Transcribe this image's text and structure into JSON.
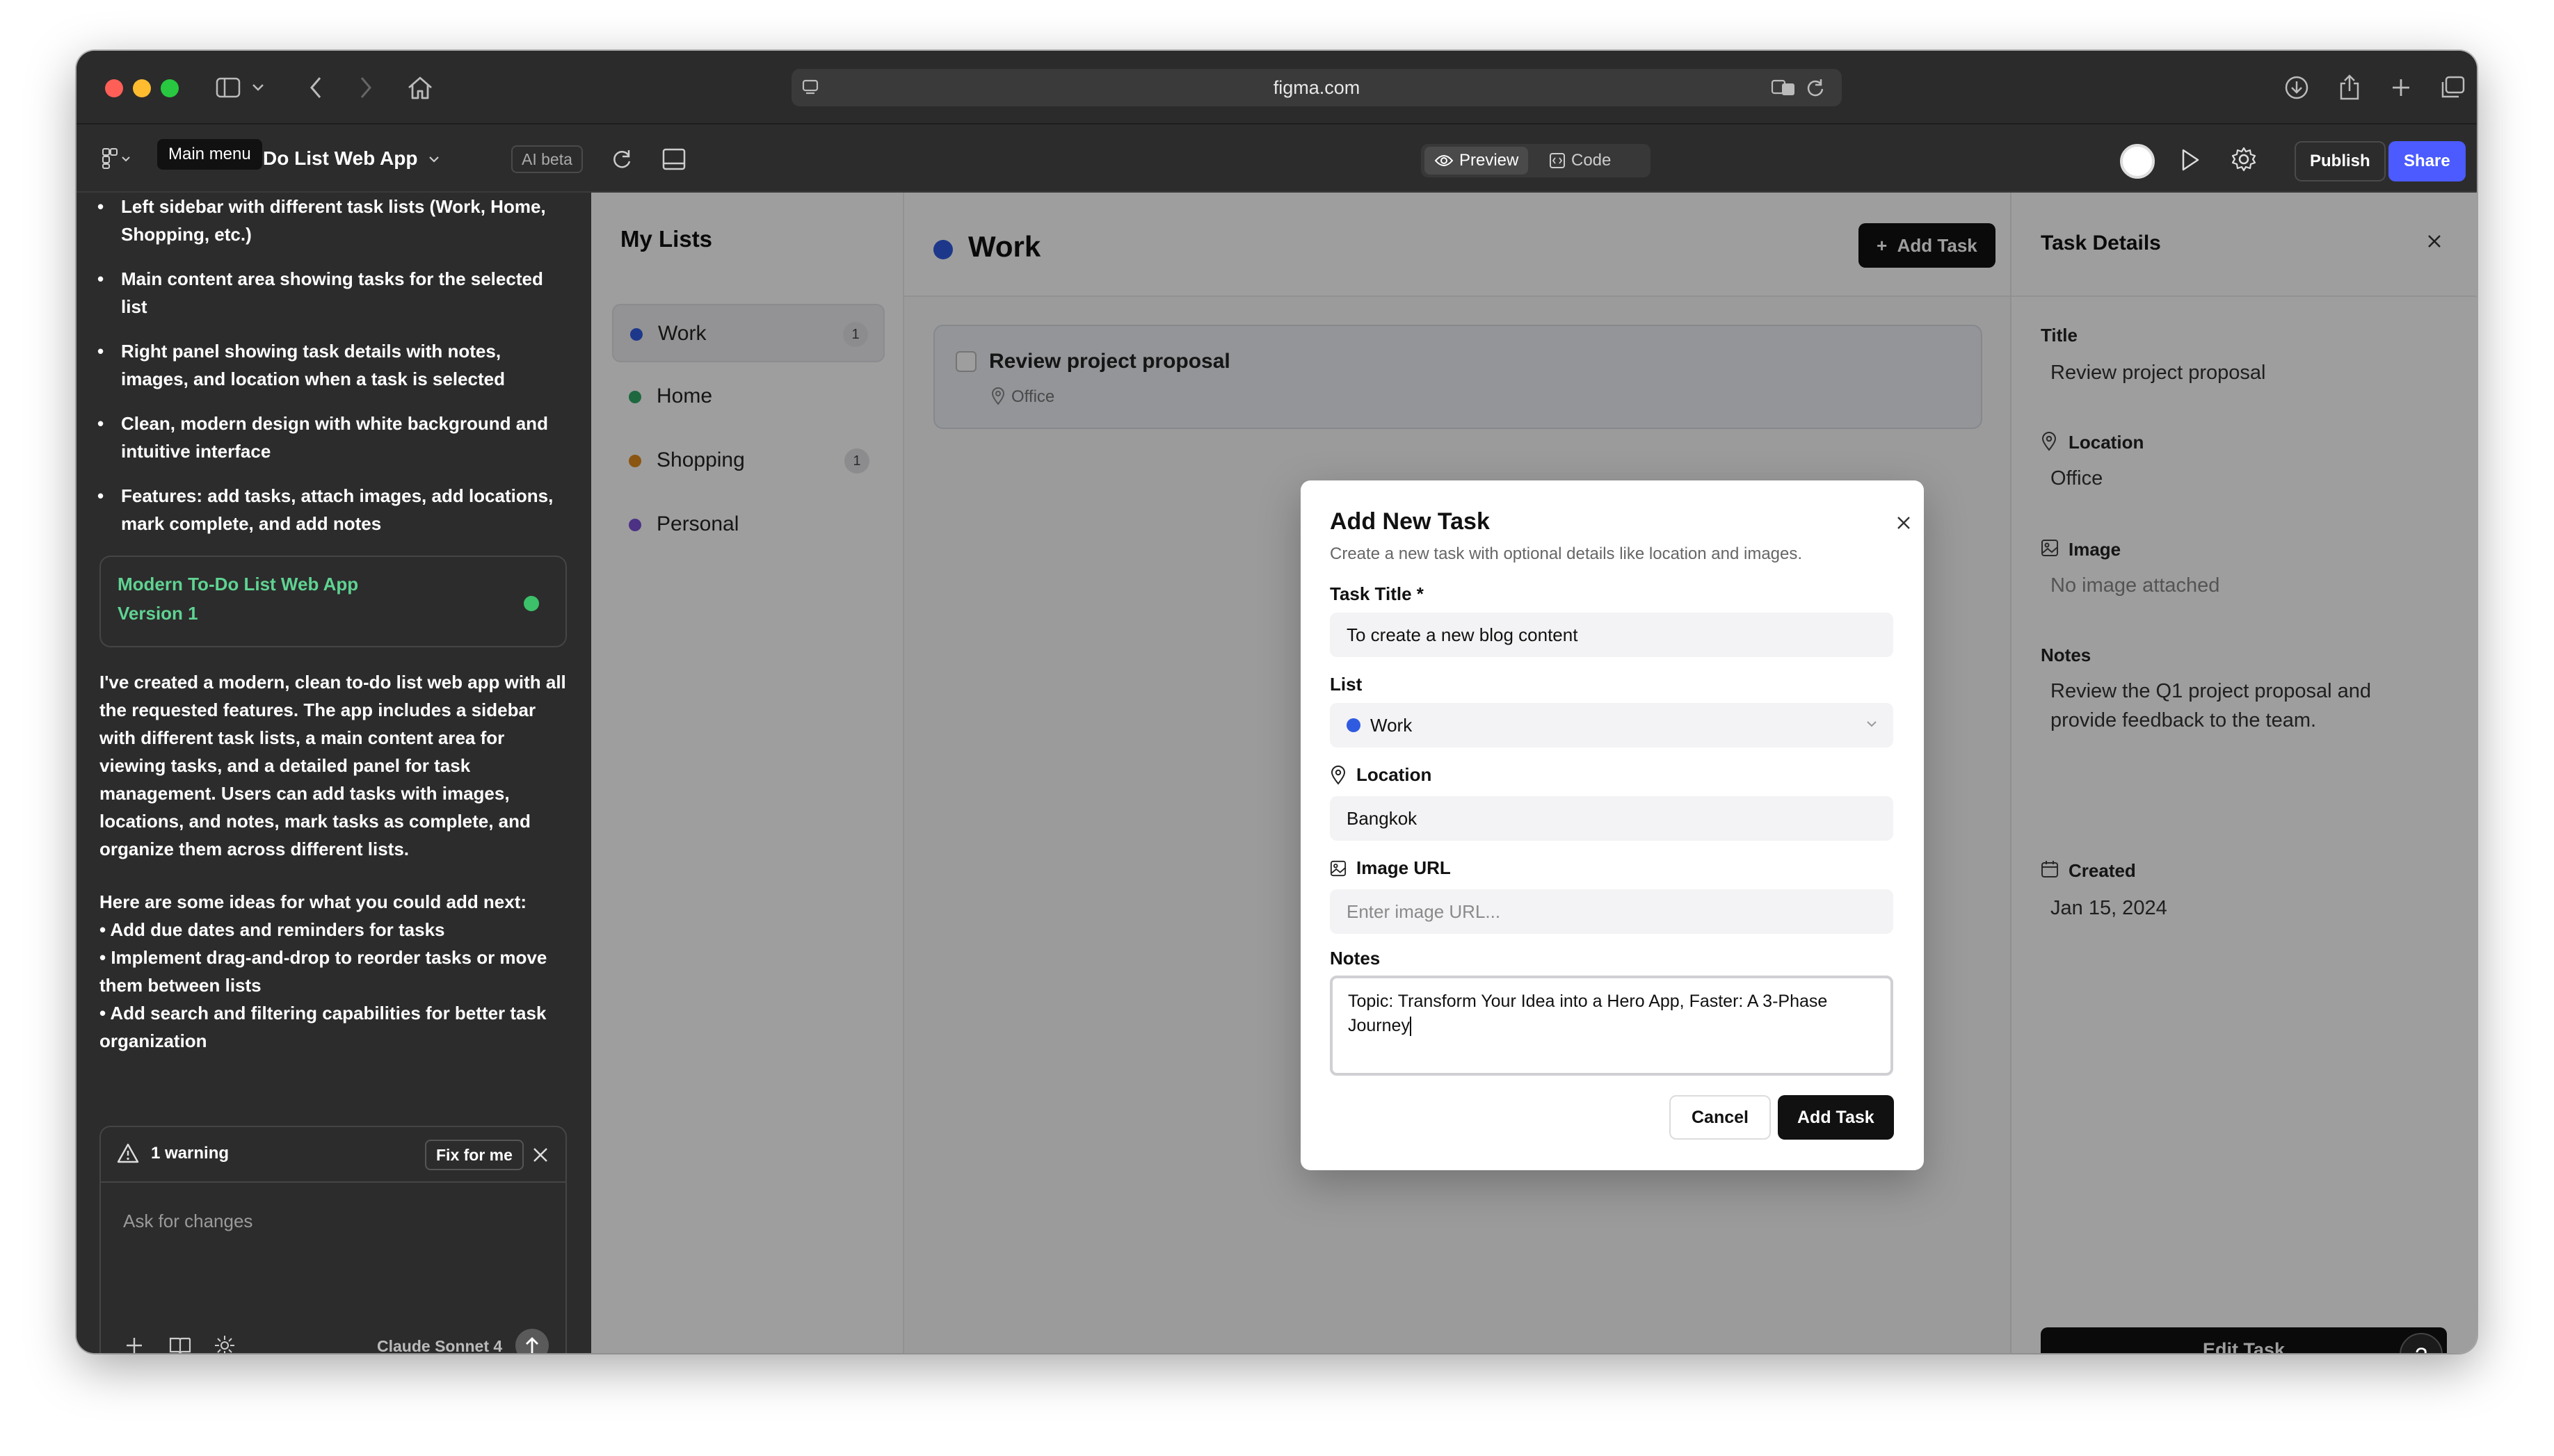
{
  "browser": {
    "url": "figma.com"
  },
  "figma": {
    "tooltip": "Main menu",
    "project_name": "Do List Web App",
    "ai_badge": "AI beta",
    "preview_label": "Preview",
    "code_label": "Code",
    "publish_label": "Publish",
    "share_label": "Share"
  },
  "chat": {
    "bullets": [
      "Left sidebar with different task lists (Work, Home, Shopping, etc.)",
      "Main content area showing tasks for the selected list",
      "Right panel showing task details with notes, images, and location when a task is selected",
      "Clean, modern design with white background and intuitive interface",
      "Features: add tasks, attach images, add locations, mark complete, and add notes"
    ],
    "version_card": {
      "title": "Modern To-Do List Web App",
      "version": "Version 1"
    },
    "summary": "I've created a modern, clean to-do list web app with all the requested features. The app includes a sidebar with different task lists, a main content area for viewing tasks, and a detailed panel for task management. Users can add tasks with images, locations, and notes, mark tasks as complete, and organize them across different lists.",
    "ideas_intro": "Here are some ideas for what you could add next:",
    "ideas": [
      "• Add due dates and reminders for tasks",
      "• Implement drag-and-drop to reorder tasks or move them between lists",
      "• Add search and filtering capabilities for better task organization"
    ],
    "warning_text": "1 warning",
    "fix_label": "Fix for me",
    "input_placeholder": "Ask for changes",
    "model_label": "Claude Sonnet 4"
  },
  "app": {
    "lists_title": "My Lists",
    "lists": [
      {
        "label": "Work",
        "count": "1",
        "color": "#2f5be0"
      },
      {
        "label": "Home",
        "count": "",
        "color": "#2fa866"
      },
      {
        "label": "Shopping",
        "count": "1",
        "color": "#e08a1e"
      },
      {
        "label": "Personal",
        "count": "",
        "color": "#7b4fd6"
      }
    ],
    "main_title": "Work",
    "add_task_label": "Add Task",
    "task": {
      "title": "Review project proposal",
      "location": "Office"
    },
    "details": {
      "header": "Task Details",
      "title_label": "Title",
      "title_value": "Review project proposal",
      "location_label": "Location",
      "location_value": "Office",
      "image_label": "Image",
      "image_value": "No image attached",
      "notes_label": "Notes",
      "notes_value": "Review the Q1 project proposal and provide feedback to the team.",
      "created_label": "Created",
      "created_value": "Jan 15, 2024",
      "edit_label": "Edit Task"
    },
    "help_label": "?"
  },
  "modal": {
    "title": "Add New Task",
    "subtitle": "Create a new task with optional details like location and images.",
    "task_title_label": "Task Title *",
    "task_title_value": "To create a new blog content",
    "list_label": "List",
    "list_value": "Work",
    "location_label": "Location",
    "location_value": "Bangkok",
    "image_url_label": "Image URL",
    "image_url_placeholder": "Enter image URL...",
    "notes_label": "Notes",
    "notes_value": "Topic: Transform Your Idea into a Hero App, Faster: A 3-Phase Journey",
    "cancel_label": "Cancel",
    "add_label": "Add Task"
  }
}
